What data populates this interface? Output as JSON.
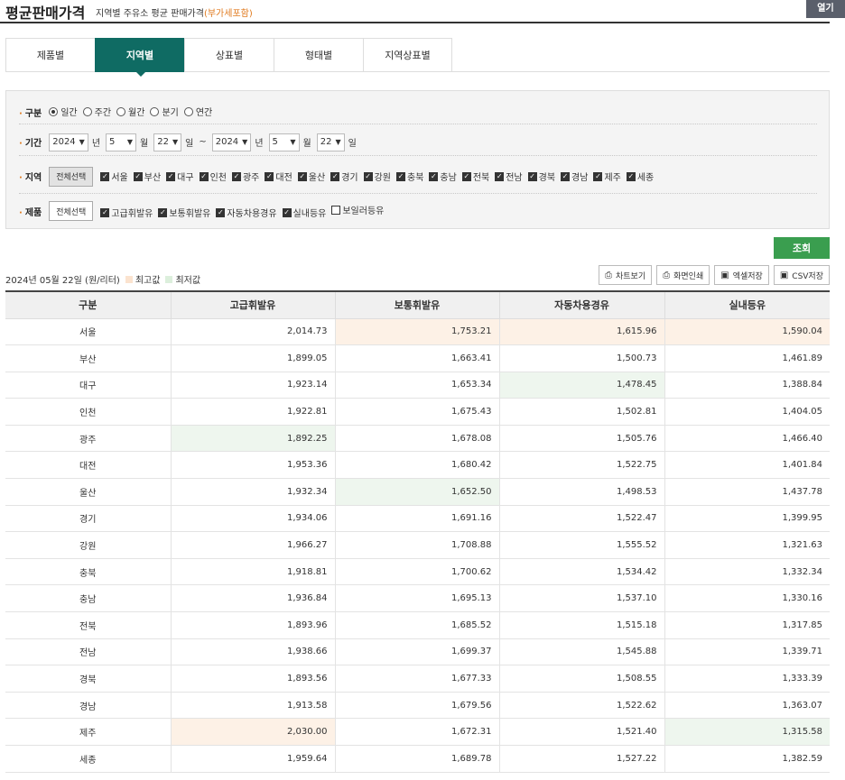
{
  "header": {
    "title": "평균판매가격",
    "subtitle": "지역별 주유소 평균 판매가격",
    "subtitle_tax": "(부가세포함)",
    "open_label": "열기"
  },
  "tabs": [
    {
      "label": "제품별",
      "active": false
    },
    {
      "label": "지역별",
      "active": true
    },
    {
      "label": "상표별",
      "active": false
    },
    {
      "label": "형태별",
      "active": false
    },
    {
      "label": "지역상표별",
      "active": false
    }
  ],
  "filter": {
    "period_type": {
      "label": "구분",
      "options": [
        "일간",
        "주간",
        "월간",
        "분기",
        "연간"
      ],
      "selected": "일간"
    },
    "date_range": {
      "label": "기간",
      "start": {
        "year": "2024",
        "month": "5",
        "day": "22"
      },
      "end": {
        "year": "2024",
        "month": "5",
        "day": "22"
      },
      "unit_year": "년",
      "unit_month": "월",
      "unit_day": "일",
      "tilde": "~"
    },
    "regions": {
      "label": "지역",
      "select_all": "전체선택",
      "items": [
        "서울",
        "부산",
        "대구",
        "인천",
        "광주",
        "대전",
        "울산",
        "경기",
        "강원",
        "충북",
        "충남",
        "전북",
        "전남",
        "경북",
        "경남",
        "제주",
        "세종"
      ]
    },
    "products": {
      "label": "제품",
      "select_all": "전체선택",
      "items": [
        {
          "label": "고급휘발유",
          "checked": true
        },
        {
          "label": "보통휘발유",
          "checked": true
        },
        {
          "label": "자동차용경유",
          "checked": true
        },
        {
          "label": "실내등유",
          "checked": true
        },
        {
          "label": "보일러등유",
          "checked": false
        }
      ]
    },
    "query_label": "조회"
  },
  "info": {
    "date_text": "2024년 05월 22일",
    "unit_text": "(원/리터)",
    "legend_max": "최고값",
    "legend_min": "최저값"
  },
  "actions": [
    {
      "label": "차트보기",
      "icon": "printer-icon"
    },
    {
      "label": "화면인쇄",
      "icon": "printer-icon"
    },
    {
      "label": "엑셀저장",
      "icon": "save-icon"
    },
    {
      "label": "CSV저장",
      "icon": "save-icon"
    }
  ],
  "colors": {
    "accent": "#0f6b63",
    "query": "#3a9e4f",
    "max_bg": "#fdf1e6",
    "min_bg": "#eef6ee"
  },
  "table": {
    "columns": [
      "구분",
      "고급휘발유",
      "보통휘발유",
      "자동차용경유",
      "실내등유"
    ],
    "rows": [
      {
        "region": "서울",
        "values": [
          "2,014.73",
          "1,753.21",
          "1,615.96",
          "1,590.04"
        ],
        "hl": [
          "",
          "hi",
          "hi",
          "hi"
        ]
      },
      {
        "region": "부산",
        "values": [
          "1,899.05",
          "1,663.41",
          "1,500.73",
          "1,461.89"
        ],
        "hl": [
          "",
          "",
          "",
          ""
        ]
      },
      {
        "region": "대구",
        "values": [
          "1,923.14",
          "1,653.34",
          "1,478.45",
          "1,388.84"
        ],
        "hl": [
          "",
          "",
          "lo",
          ""
        ]
      },
      {
        "region": "인천",
        "values": [
          "1,922.81",
          "1,675.43",
          "1,502.81",
          "1,404.05"
        ],
        "hl": [
          "",
          "",
          "",
          ""
        ]
      },
      {
        "region": "광주",
        "values": [
          "1,892.25",
          "1,678.08",
          "1,505.76",
          "1,466.40"
        ],
        "hl": [
          "lo",
          "",
          "",
          ""
        ]
      },
      {
        "region": "대전",
        "values": [
          "1,953.36",
          "1,680.42",
          "1,522.75",
          "1,401.84"
        ],
        "hl": [
          "",
          "",
          "",
          ""
        ]
      },
      {
        "region": "울산",
        "values": [
          "1,932.34",
          "1,652.50",
          "1,498.53",
          "1,437.78"
        ],
        "hl": [
          "",
          "lo",
          "",
          ""
        ]
      },
      {
        "region": "경기",
        "values": [
          "1,934.06",
          "1,691.16",
          "1,522.47",
          "1,399.95"
        ],
        "hl": [
          "",
          "",
          "",
          ""
        ]
      },
      {
        "region": "강원",
        "values": [
          "1,966.27",
          "1,708.88",
          "1,555.52",
          "1,321.63"
        ],
        "hl": [
          "",
          "",
          "",
          ""
        ]
      },
      {
        "region": "충북",
        "values": [
          "1,918.81",
          "1,700.62",
          "1,534.42",
          "1,332.34"
        ],
        "hl": [
          "",
          "",
          "",
          ""
        ]
      },
      {
        "region": "충남",
        "values": [
          "1,936.84",
          "1,695.13",
          "1,537.10",
          "1,330.16"
        ],
        "hl": [
          "",
          "",
          "",
          ""
        ]
      },
      {
        "region": "전북",
        "values": [
          "1,893.96",
          "1,685.52",
          "1,515.18",
          "1,317.85"
        ],
        "hl": [
          "",
          "",
          "",
          ""
        ]
      },
      {
        "region": "전남",
        "values": [
          "1,938.66",
          "1,699.37",
          "1,545.88",
          "1,339.71"
        ],
        "hl": [
          "",
          "",
          "",
          ""
        ]
      },
      {
        "region": "경북",
        "values": [
          "1,893.56",
          "1,677.33",
          "1,508.55",
          "1,333.39"
        ],
        "hl": [
          "",
          "",
          "",
          ""
        ]
      },
      {
        "region": "경남",
        "values": [
          "1,913.58",
          "1,679.56",
          "1,522.62",
          "1,363.07"
        ],
        "hl": [
          "",
          "",
          "",
          ""
        ]
      },
      {
        "region": "제주",
        "values": [
          "2,030.00",
          "1,672.31",
          "1,521.40",
          "1,315.58"
        ],
        "hl": [
          "hi",
          "",
          "",
          "lo"
        ]
      },
      {
        "region": "세종",
        "values": [
          "1,959.64",
          "1,689.78",
          "1,527.22",
          "1,382.59"
        ],
        "hl": [
          "",
          "",
          "",
          ""
        ]
      }
    ]
  }
}
